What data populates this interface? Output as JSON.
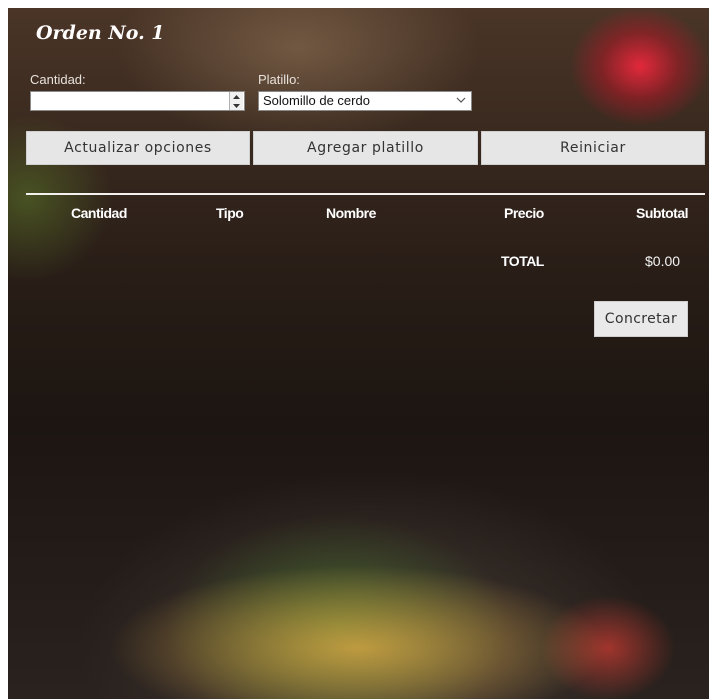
{
  "order": {
    "title": "Orden No. 1"
  },
  "form": {
    "quantity_label": "Cantidad:",
    "quantity_value": "",
    "dish_label": "Platillo:",
    "dish_selected": "Solomillo de cerdo"
  },
  "buttons": {
    "update_options": "Actualizar opciones",
    "add_dish": "Agregar platillo",
    "reset": "Reiniciar",
    "confirm": "Concretar"
  },
  "table": {
    "headers": [
      "Cantidad",
      "Tipo",
      "Nombre",
      "Precio",
      "Subtotal"
    ],
    "rows": [],
    "total_label": "TOTAL",
    "total_value": "$0.00"
  }
}
